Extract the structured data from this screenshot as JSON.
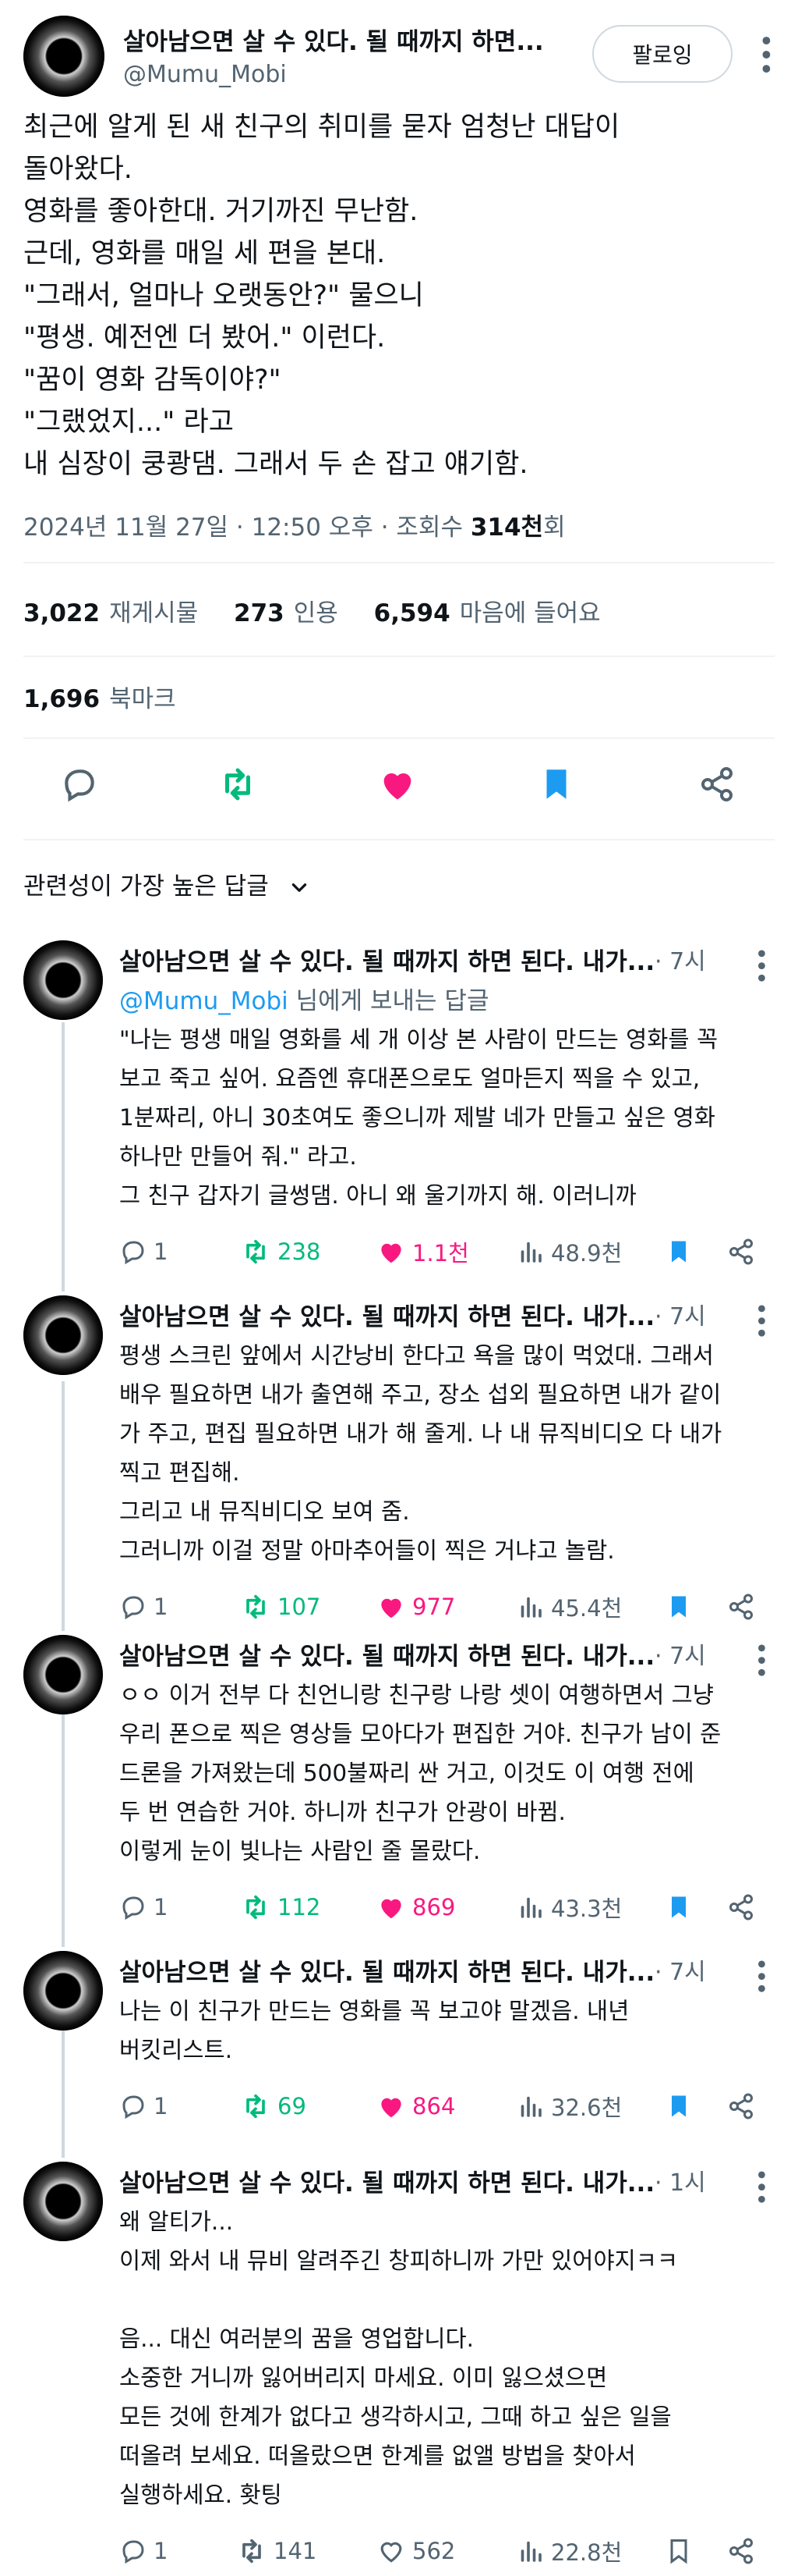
{
  "main": {
    "name": "살아남으면 살 수 있다. 될 때까지 하면...",
    "handle": "@Mumu_Mobi",
    "follow_label": "팔로잉",
    "text_lines": [
      "최근에 알게 된 새 친구의 취미를 묻자 엄청난 대답이",
      "돌아왔다.",
      "영화를 좋아한대. 거기까진 무난함.",
      "근데, 영화를 매일 세 편을 본대.",
      "\"그래서, 얼마나 오랫동안?\" 물으니",
      "\"평생. 예전엔 더 봤어.\" 이런다.",
      "\"꿈이 영화 감독이야?\"",
      "\"그랬었지...\" 라고",
      "내 심장이 쿵쾅댐. 그래서 두 손 잡고 얘기함."
    ],
    "meta_prefix": "2024년 11월 27일 · 12:50 오후 · 조회수 ",
    "meta_views": "314천",
    "meta_suffix": "회",
    "stats": {
      "retweets": "3,022",
      "retweets_label": "재게시물",
      "quotes": "273",
      "quotes_label": "인용",
      "likes": "6,594",
      "likes_label": "마음에 들어요",
      "bookmarks": "1,696",
      "bookmarks_label": "북마크"
    },
    "sort_label": "관련성이 가장 높은 답글"
  },
  "replies": [
    {
      "name": "살아남으면 살 수 있다. 될 때까지 하면 된다. 내가...",
      "time": "· 7시",
      "to_handle": "@Mumu_Mobi",
      "to_suffix": " 님에게 보내는 답글",
      "lines": [
        "\"나는 평생 매일 영화를 세 개 이상 본 사람이 만드는 영화를 꼭",
        "보고 죽고 싶어. 요즘엔 휴대폰으로도 얼마든지 찍을 수 있고,",
        "1분짜리, 아니 30초여도 좋으니까 제발 네가 만들고 싶은 영화",
        "하나만 만들어 줘.\" 라고.",
        "그 친구 갑자기 글썽댐. 아니 왜 울기까지 해. 이러니까"
      ],
      "replies": "1",
      "retweets": "238",
      "likes": "1.1천",
      "views": "48.9천",
      "liked": true
    },
    {
      "name": "살아남으면 살 수 있다. 될 때까지 하면 된다. 내가...",
      "time": "· 7시",
      "lines": [
        "평생 스크린 앞에서 시간낭비 한다고 욕을 많이 먹었대. 그래서",
        "배우 필요하면 내가 출연해 주고, 장소 섭외 필요하면 내가 같이",
        "가 주고, 편집 필요하면 내가 해 줄게. 나 내 뮤직비디오 다 내가",
        "찍고 편집해.",
        "그리고 내 뮤직비디오 보여 줌.",
        "그러니까 이걸 정말 아마추어들이 찍은 거냐고 놀람."
      ],
      "replies": "1",
      "retweets": "107",
      "likes": "977",
      "views": "45.4천",
      "liked": true
    },
    {
      "name": "살아남으면 살 수 있다. 될 때까지 하면 된다. 내가...",
      "time": "· 7시",
      "lines": [
        "ㅇㅇ 이거 전부 다 친언니랑 친구랑 나랑 셋이 여행하면서 그냥",
        "우리 폰으로 찍은 영상들 모아다가 편집한 거야. 친구가 남이 준",
        "드론을 가져왔는데 500불짜리 싼 거고, 이것도 이 여행 전에",
        "두 번 연습한 거야. 하니까 친구가 안광이 바뀜.",
        "이렇게 눈이 빛나는 사람인 줄 몰랐다."
      ],
      "replies": "1",
      "retweets": "112",
      "likes": "869",
      "views": "43.3천",
      "liked": true
    },
    {
      "name": "살아남으면 살 수 있다. 될 때까지 하면 된다. 내가...",
      "time": "· 7시",
      "lines": [
        "나는 이 친구가 만드는 영화를 꼭 보고야 말겠음. 내년",
        "버킷리스트."
      ],
      "replies": "1",
      "retweets": "69",
      "likes": "864",
      "views": "32.6천",
      "liked": true
    },
    {
      "name": "살아남으면 살 수 있다. 될 때까지 하면 된다. 내가...",
      "time": "· 1시",
      "lines": [
        "왜 알티가...",
        "이제 와서 내 뮤비 알려주긴 창피하니까 가만 있어야지ㅋㅋ",
        "",
        "음... 대신 여러분의 꿈을 영업합니다.",
        "소중한 거니까 잃어버리지 마세요. 이미 잃으셨으면",
        "모든 것에 한계가 없다고 생각하시고, 그때 하고 싶은 일을",
        "떠올려 보세요. 떠올랐으면 한계를 없앨 방법을 찾아서",
        "실행하세요. 홧팅"
      ],
      "replies": "1",
      "retweets": "141",
      "likes": "562",
      "views": "22.8천",
      "liked": false
    }
  ],
  "colors": {
    "blue": "#1d9bf0",
    "green": "#00ba7c",
    "pink": "#f91880",
    "gray": "#536471"
  },
  "icons": [
    "reply-icon",
    "retweet-icon",
    "heart-icon",
    "bookmark-icon",
    "share-icon",
    "views-icon",
    "chevron-down-icon",
    "more-icon"
  ]
}
